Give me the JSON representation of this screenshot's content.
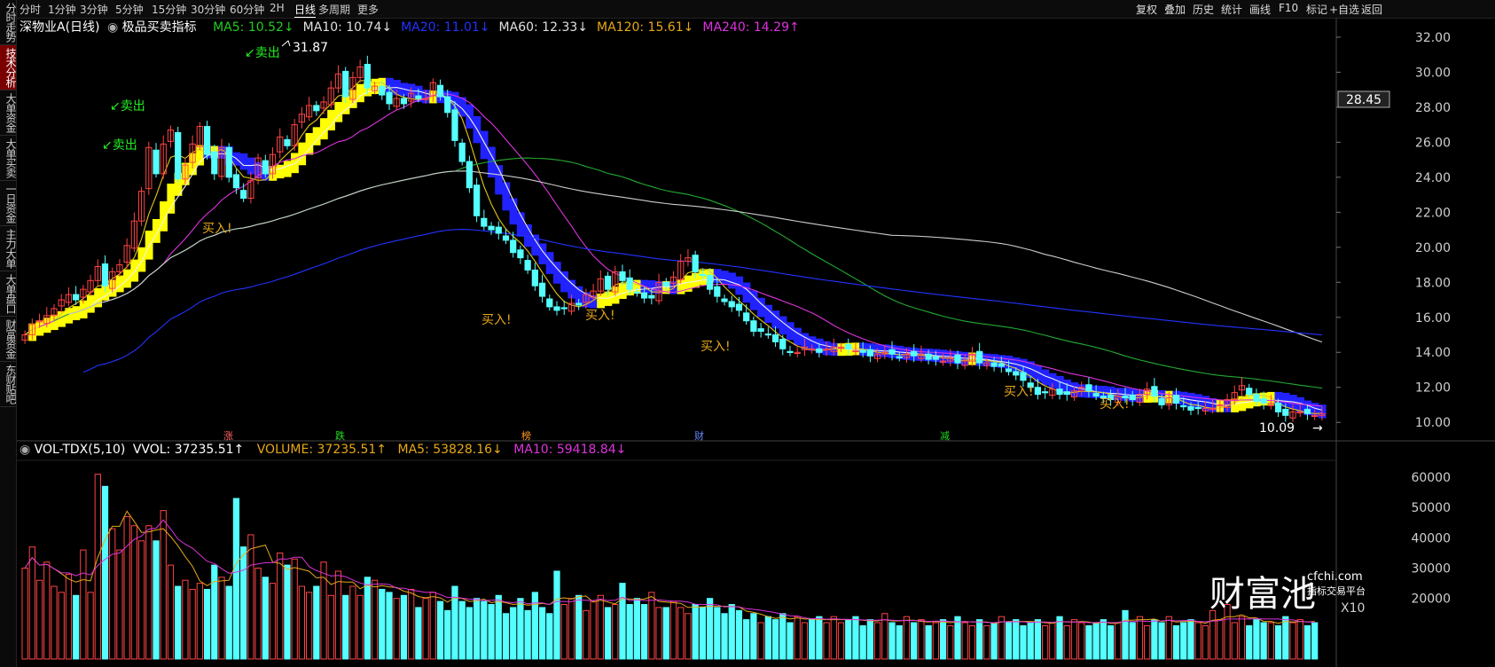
{
  "sidebar": {
    "items": [
      "分时走势",
      "技术分析",
      "大单资金",
      "大单买卖",
      "一日资金",
      "主力大单",
      "大单盘口",
      "财富资金",
      "东财贴吧"
    ]
  },
  "toolbar": {
    "periods": [
      "分时",
      "1分钟",
      "3分钟",
      "5分钟",
      "15分钟",
      "30分钟",
      "60分钟",
      "2H",
      "日线",
      "多周期",
      "更多"
    ],
    "active": "日线",
    "right_buttons": [
      "复权",
      "叠加",
      "历史",
      "统计",
      "画线",
      "F10",
      "标记",
      "+自选",
      "返回"
    ]
  },
  "main_header": {
    "stock": "深物业A(日线)",
    "indicator": "极品买卖指标",
    "ma": [
      {
        "label": "MA5: 10.52",
        "arrow": "↓",
        "color": "#22cc22"
      },
      {
        "label": "MA10: 10.74",
        "arrow": "↓",
        "color": "#e0e0e0"
      },
      {
        "label": "MA20: 11.01",
        "arrow": "↓",
        "color": "#2233ff"
      },
      {
        "label": "MA60: 12.33",
        "arrow": "↓",
        "color": "#e0e0e0"
      },
      {
        "label": "MA120: 15.61",
        "arrow": "↓",
        "color": "#e6a817"
      },
      {
        "label": "MA240: 14.29",
        "arrow": "↑",
        "color": "#dd33dd"
      }
    ]
  },
  "vol_header": {
    "name": "VOL-TDX(5,10)",
    "vvol": "VVOL: 37235.51↑",
    "volume": "VOLUME: 37235.51↑",
    "ma5": "MA5: 53828.16↓",
    "ma10": "MA10: 59418.84↓"
  },
  "annotations": {
    "high_label": "31.87",
    "low_label": "10.09",
    "last_price": "28.45",
    "sell": "卖出",
    "buy": "买入!",
    "event_markers": [
      "涨",
      "跌",
      "榜",
      "财",
      "减"
    ],
    "multiplier": "X10"
  },
  "watermark": {
    "brand": "财富池",
    "url": "cfchi.com",
    "tagline": "指标交易平台"
  },
  "colors": {
    "up": "#ff4444",
    "down": "#55ffff",
    "band_up": "#ffff00",
    "band_down": "#2222ff"
  },
  "chart_data": [
    {
      "type": "candlestick",
      "axis": {
        "ylim": [
          9.2,
          32.3
        ],
        "yticks": [
          10,
          12,
          14,
          16,
          18,
          20,
          22,
          24,
          26,
          28,
          30,
          32
        ]
      },
      "close": [
        15,
        15.6,
        15.8,
        16.1,
        16.5,
        17.0,
        17.3,
        17.0,
        17.6,
        18.1,
        18.9,
        17.8,
        18.6,
        19.0,
        20.1,
        21.5,
        23.2,
        25.7,
        24.2,
        25.9,
        26.7,
        23.9,
        24.7,
        25.9,
        26.9,
        25.3,
        24.2,
        25.7,
        24.0,
        23.4,
        22.8,
        23.8,
        25.1,
        24.2,
        25.3,
        26.3,
        25.8,
        27.0,
        27.6,
        28.1,
        27.8,
        28.3,
        29.1,
        29.9,
        28.6,
        29.7,
        30.3,
        29.1,
        29.2,
        28.7,
        28.2,
        28.5,
        28.2,
        28.8,
        28.5,
        28.5,
        29.4,
        28.6,
        27.7,
        26.1,
        24.9,
        23.4,
        21.8,
        21.2,
        21.0,
        20.8,
        20.4,
        19.7,
        19.4,
        18.7,
        17.8,
        17.2,
        16.6,
        16.4,
        16.5,
        16.8,
        16.7,
        17.3,
        17.5,
        18.2,
        17.6,
        18.6,
        18.1,
        17.6,
        17.4,
        17.1,
        17.1,
        18.0,
        17.8,
        18.3,
        19.2,
        19.4,
        18.6,
        18.4,
        17.6,
        17.2,
        16.9,
        16.6,
        16.4,
        15.8,
        15.2,
        15.2,
        15.0,
        14.6,
        14.2,
        14.0,
        14.0,
        14.3,
        14.2,
        14.0,
        14.2,
        14.3,
        14.3,
        14.2,
        14.1,
        14.0,
        13.8,
        13.9,
        14.0,
        13.9,
        13.7,
        13.9,
        13.8,
        13.9,
        13.6,
        13.6,
        13.5,
        13.7,
        13.4,
        13.5,
        13.9,
        13.4,
        13.4,
        13.2,
        13.2,
        12.9,
        12.7,
        12.4,
        12.0,
        11.6,
        11.7,
        11.9,
        11.6,
        11.6,
        11.8,
        12.0,
        11.8,
        11.5,
        11.4,
        11.3,
        11.5,
        11.4,
        11.3,
        11.6,
        11.9,
        11.5,
        11.0,
        11.4,
        11.1,
        10.9,
        10.7,
        10.8,
        10.8,
        10.8,
        11.0,
        11.3,
        11.7,
        12.1,
        11.6,
        11.2,
        11.1,
        11.1,
        10.6,
        10.4,
        10.6,
        10.6,
        10.5,
        10.4,
        10.5
      ]
    },
    {
      "type": "bar",
      "axis": {
        "ylim": [
          0,
          65000
        ],
        "yticks": [
          20000,
          30000,
          40000,
          50000,
          60000
        ]
      },
      "values": [
        30000,
        37000,
        26000,
        32000,
        24000,
        22000,
        28000,
        21000,
        36000,
        22000,
        61000,
        57000,
        43000,
        36000,
        47000,
        44000,
        39000,
        44000,
        39000,
        49000,
        31000,
        24000,
        26000,
        23000,
        25000,
        23000,
        31000,
        27000,
        24000,
        53000,
        37000,
        41000,
        30000,
        27000,
        25000,
        35000,
        31000,
        33000,
        24000,
        22000,
        24000,
        32000,
        21000,
        29000,
        21000,
        24000,
        21000,
        27000,
        26000,
        23000,
        22000,
        20000,
        21000,
        23000,
        17000,
        20000,
        22000,
        19000,
        16000,
        24000,
        19000,
        17000,
        20000,
        19000,
        18000,
        21000,
        15000,
        17000,
        20000,
        16000,
        22000,
        17000,
        15000,
        29000,
        18000,
        20000,
        21000,
        16000,
        19000,
        21000,
        17000,
        18000,
        25000,
        18000,
        20000,
        18000,
        22000,
        17000,
        17000,
        19000,
        17000,
        15000,
        18000,
        17000,
        20000,
        17000,
        15000,
        18000,
        16000,
        13000,
        15000,
        12000,
        14000,
        13000,
        15000,
        12000,
        14000,
        12000,
        13000,
        14000,
        12000,
        14000,
        12000,
        13000,
        14000,
        11000,
        13000,
        12000,
        15000,
        12000,
        11000,
        14000,
        12000,
        13000,
        11000,
        12000,
        13000,
        11000,
        14000,
        12000,
        11000,
        13000,
        11000,
        12000,
        14000,
        12000,
        13000,
        11000,
        12000,
        13000,
        11000,
        12000,
        14000,
        11000,
        13000,
        12000,
        11000,
        12000,
        13000,
        11000,
        12000,
        16000,
        12000,
        14000,
        11000,
        13000,
        12000,
        14000,
        11000,
        12000,
        13000,
        12000,
        11000,
        16000,
        13000,
        18000,
        12000,
        14000,
        11000,
        13000,
        12000,
        12000,
        11000,
        14000,
        12000,
        13000,
        11000,
        12000
      ]
    }
  ]
}
